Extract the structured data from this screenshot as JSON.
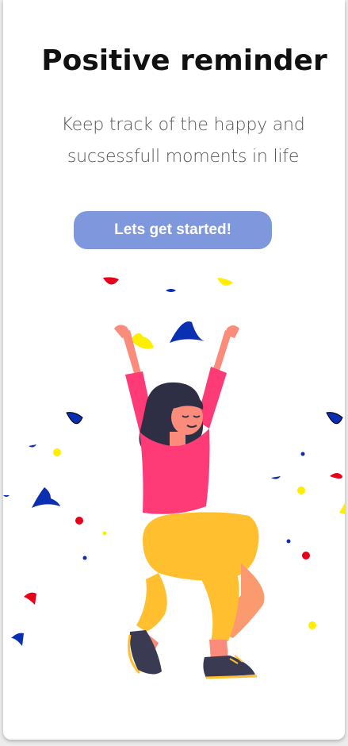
{
  "onboarding": {
    "title": "Positive reminder",
    "subtitle": "Keep track of the happy and sucsessfull moments in life",
    "cta_label": "Lets get started!"
  },
  "colors": {
    "accent": "#7f97dc",
    "shirt": "#ff3b77",
    "pants": "#ffbf2e",
    "skin": "#fb8b7a",
    "hair": "#2e2f45",
    "confetti_blue": "#0a2fb0",
    "confetti_red": "#e8001a",
    "confetti_yellow": "#ffee00"
  },
  "illustration": {
    "name": "celebrating-woman-illustration"
  }
}
